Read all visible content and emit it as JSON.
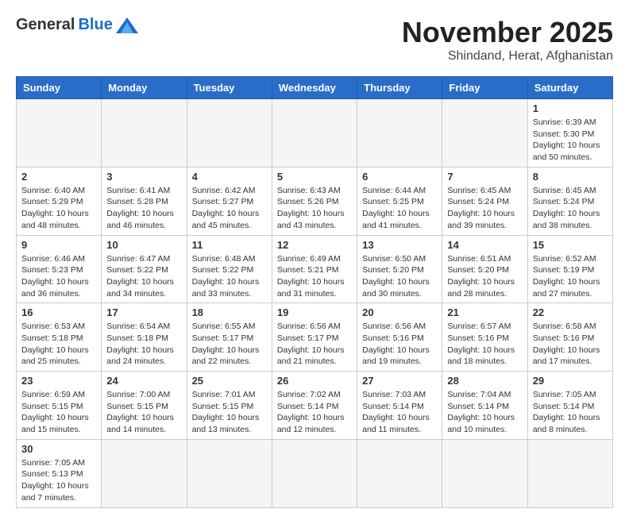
{
  "header": {
    "logo_general": "General",
    "logo_blue": "Blue",
    "title": "November 2025",
    "location": "Shindand, Herat, Afghanistan"
  },
  "days_of_week": [
    "Sunday",
    "Monday",
    "Tuesday",
    "Wednesday",
    "Thursday",
    "Friday",
    "Saturday"
  ],
  "weeks": [
    [
      {
        "day": "",
        "info": ""
      },
      {
        "day": "",
        "info": ""
      },
      {
        "day": "",
        "info": ""
      },
      {
        "day": "",
        "info": ""
      },
      {
        "day": "",
        "info": ""
      },
      {
        "day": "",
        "info": ""
      },
      {
        "day": "1",
        "info": "Sunrise: 6:39 AM\nSunset: 5:30 PM\nDaylight: 10 hours and 50 minutes."
      }
    ],
    [
      {
        "day": "2",
        "info": "Sunrise: 6:40 AM\nSunset: 5:29 PM\nDaylight: 10 hours and 48 minutes."
      },
      {
        "day": "3",
        "info": "Sunrise: 6:41 AM\nSunset: 5:28 PM\nDaylight: 10 hours and 46 minutes."
      },
      {
        "day": "4",
        "info": "Sunrise: 6:42 AM\nSunset: 5:27 PM\nDaylight: 10 hours and 45 minutes."
      },
      {
        "day": "5",
        "info": "Sunrise: 6:43 AM\nSunset: 5:26 PM\nDaylight: 10 hours and 43 minutes."
      },
      {
        "day": "6",
        "info": "Sunrise: 6:44 AM\nSunset: 5:25 PM\nDaylight: 10 hours and 41 minutes."
      },
      {
        "day": "7",
        "info": "Sunrise: 6:45 AM\nSunset: 5:24 PM\nDaylight: 10 hours and 39 minutes."
      },
      {
        "day": "8",
        "info": "Sunrise: 6:45 AM\nSunset: 5:24 PM\nDaylight: 10 hours and 38 minutes."
      }
    ],
    [
      {
        "day": "9",
        "info": "Sunrise: 6:46 AM\nSunset: 5:23 PM\nDaylight: 10 hours and 36 minutes."
      },
      {
        "day": "10",
        "info": "Sunrise: 6:47 AM\nSunset: 5:22 PM\nDaylight: 10 hours and 34 minutes."
      },
      {
        "day": "11",
        "info": "Sunrise: 6:48 AM\nSunset: 5:22 PM\nDaylight: 10 hours and 33 minutes."
      },
      {
        "day": "12",
        "info": "Sunrise: 6:49 AM\nSunset: 5:21 PM\nDaylight: 10 hours and 31 minutes."
      },
      {
        "day": "13",
        "info": "Sunrise: 6:50 AM\nSunset: 5:20 PM\nDaylight: 10 hours and 30 minutes."
      },
      {
        "day": "14",
        "info": "Sunrise: 6:51 AM\nSunset: 5:20 PM\nDaylight: 10 hours and 28 minutes."
      },
      {
        "day": "15",
        "info": "Sunrise: 6:52 AM\nSunset: 5:19 PM\nDaylight: 10 hours and 27 minutes."
      }
    ],
    [
      {
        "day": "16",
        "info": "Sunrise: 6:53 AM\nSunset: 5:18 PM\nDaylight: 10 hours and 25 minutes."
      },
      {
        "day": "17",
        "info": "Sunrise: 6:54 AM\nSunset: 5:18 PM\nDaylight: 10 hours and 24 minutes."
      },
      {
        "day": "18",
        "info": "Sunrise: 6:55 AM\nSunset: 5:17 PM\nDaylight: 10 hours and 22 minutes."
      },
      {
        "day": "19",
        "info": "Sunrise: 6:56 AM\nSunset: 5:17 PM\nDaylight: 10 hours and 21 minutes."
      },
      {
        "day": "20",
        "info": "Sunrise: 6:56 AM\nSunset: 5:16 PM\nDaylight: 10 hours and 19 minutes."
      },
      {
        "day": "21",
        "info": "Sunrise: 6:57 AM\nSunset: 5:16 PM\nDaylight: 10 hours and 18 minutes."
      },
      {
        "day": "22",
        "info": "Sunrise: 6:58 AM\nSunset: 5:16 PM\nDaylight: 10 hours and 17 minutes."
      }
    ],
    [
      {
        "day": "23",
        "info": "Sunrise: 6:59 AM\nSunset: 5:15 PM\nDaylight: 10 hours and 15 minutes."
      },
      {
        "day": "24",
        "info": "Sunrise: 7:00 AM\nSunset: 5:15 PM\nDaylight: 10 hours and 14 minutes."
      },
      {
        "day": "25",
        "info": "Sunrise: 7:01 AM\nSunset: 5:15 PM\nDaylight: 10 hours and 13 minutes."
      },
      {
        "day": "26",
        "info": "Sunrise: 7:02 AM\nSunset: 5:14 PM\nDaylight: 10 hours and 12 minutes."
      },
      {
        "day": "27",
        "info": "Sunrise: 7:03 AM\nSunset: 5:14 PM\nDaylight: 10 hours and 11 minutes."
      },
      {
        "day": "28",
        "info": "Sunrise: 7:04 AM\nSunset: 5:14 PM\nDaylight: 10 hours and 10 minutes."
      },
      {
        "day": "29",
        "info": "Sunrise: 7:05 AM\nSunset: 5:14 PM\nDaylight: 10 hours and 8 minutes."
      }
    ],
    [
      {
        "day": "30",
        "info": "Sunrise: 7:05 AM\nSunset: 5:13 PM\nDaylight: 10 hours and 7 minutes."
      },
      {
        "day": "",
        "info": ""
      },
      {
        "day": "",
        "info": ""
      },
      {
        "day": "",
        "info": ""
      },
      {
        "day": "",
        "info": ""
      },
      {
        "day": "",
        "info": ""
      },
      {
        "day": "",
        "info": ""
      }
    ]
  ]
}
